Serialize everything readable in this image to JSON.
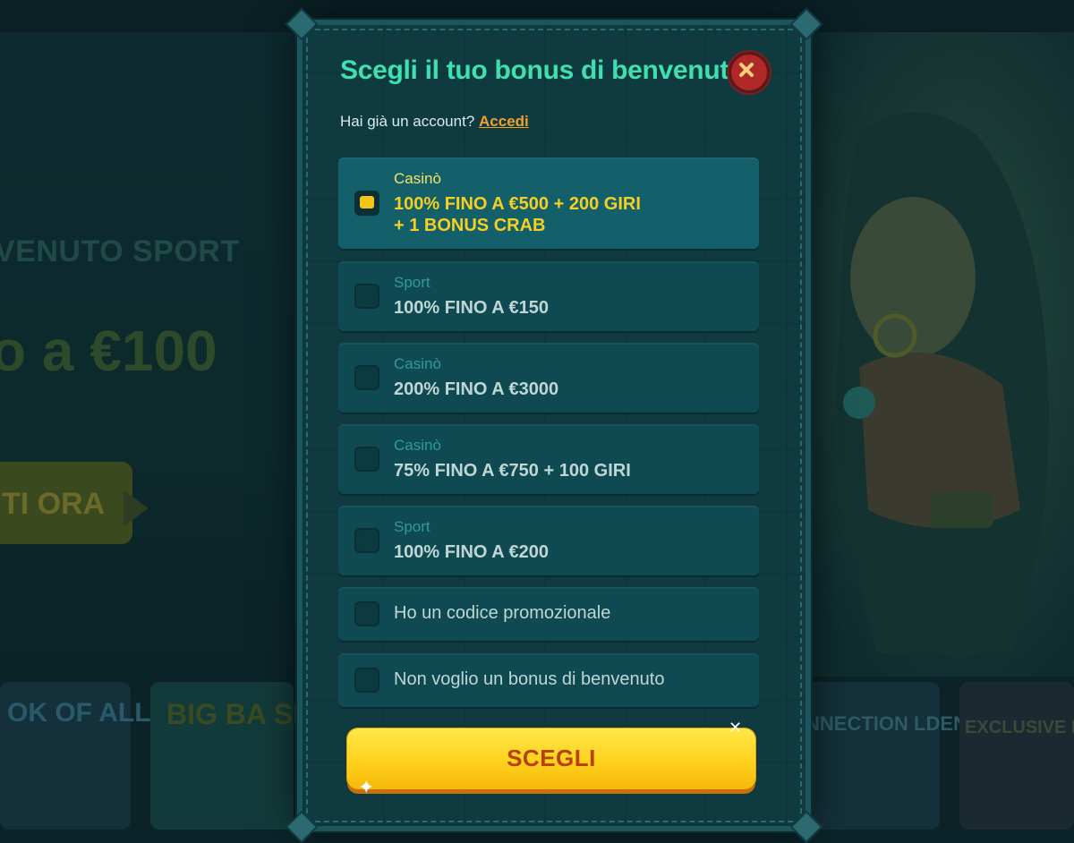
{
  "background": {
    "hero_title": "VENUTO SPORT",
    "hero_amount": "o a €100",
    "hero_cta": "TI ORA",
    "games": [
      "OK OF ALLEN",
      "BIG BA SPLAS",
      "NNECTION LDEN ORRA",
      "EXCLUSIVE BAN"
    ]
  },
  "modal": {
    "title": "Scegli il tuo bonus di benvenuto",
    "close_icon": "close-icon",
    "login_prompt": "Hai già un account?",
    "login_link": "Accedi",
    "options": [
      {
        "category": "Casinò",
        "line1": "100% FINO A €500 + 200 GIRI",
        "line2": "+ 1 BONUS CRAB",
        "selected": true
      },
      {
        "category": "Sport",
        "line1": "100% FINO A €150",
        "selected": false
      },
      {
        "category": "Casinò",
        "line1": "200% FINO A €3000",
        "selected": false
      },
      {
        "category": "Casinò",
        "line1": "75% FINO A €750 + 100 GIRI",
        "selected": false
      },
      {
        "category": "Sport",
        "line1": "100% FINO A €200",
        "selected": false
      },
      {
        "label": "Ho un codice promozionale",
        "selected": false
      },
      {
        "label": "Non voglio un bonus di benvenuto",
        "selected": false
      }
    ],
    "submit_label": "SCEGLI"
  },
  "colors": {
    "accent_title": "#3fe0b0",
    "selected_text": "#f5cf22",
    "link": "#f0a12a",
    "cta": "#ffd21c",
    "close": "#b02828"
  }
}
